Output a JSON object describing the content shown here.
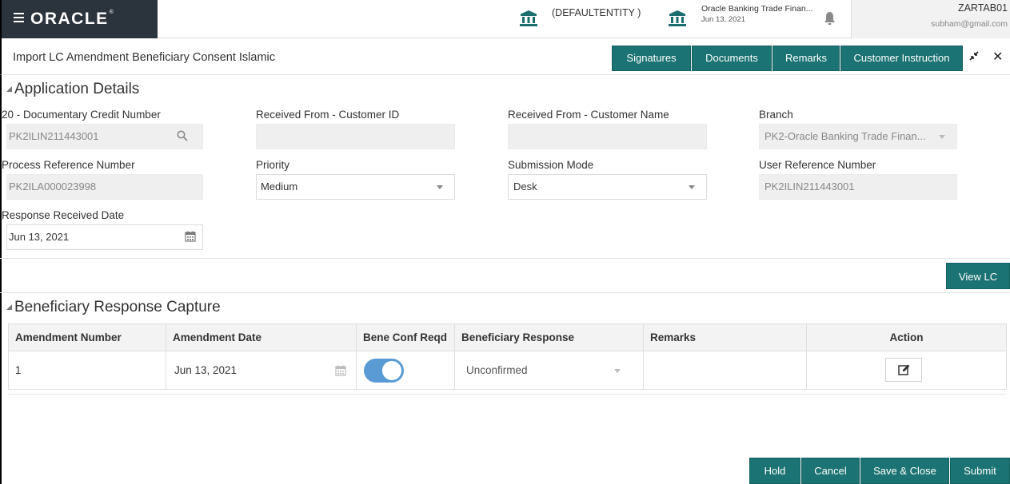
{
  "header": {
    "brand": "ORACLE",
    "entity": "(DEFAULTENTITY )",
    "context_title": "Oracle Banking Trade Finan...",
    "context_date": "Jun 13, 2021",
    "user_name": "ZARTAB01",
    "user_email": "subham@gmail.com"
  },
  "titlebar": {
    "title": "Import LC Amendment Beneficiary Consent Islamic",
    "buttons": [
      "Signatures",
      "Documents",
      "Remarks",
      "Customer Instruction"
    ]
  },
  "application_details": {
    "heading": "Application Details",
    "documentary_credit_number": {
      "label": "20 - Documentary Credit Number",
      "value": "PK2ILIN211443001"
    },
    "customer_id": {
      "label": "Received From - Customer ID",
      "value": ""
    },
    "customer_name": {
      "label": "Received From - Customer Name",
      "value": ""
    },
    "branch": {
      "label": "Branch",
      "value": "PK2-Oracle Banking Trade Finan..."
    },
    "process_reference": {
      "label": "Process Reference Number",
      "value": "PK2ILA000023998"
    },
    "priority": {
      "label": "Priority",
      "value": "Medium"
    },
    "submission_mode": {
      "label": "Submission Mode",
      "value": "Desk"
    },
    "user_reference": {
      "label": "User Reference Number",
      "value": "PK2ILIN211443001"
    },
    "response_received_date": {
      "label": "Response Received Date",
      "value": "Jun 13, 2021"
    }
  },
  "view_lc_label": "View LC",
  "beneficiary_response": {
    "heading": "Beneficiary Response Capture",
    "columns": [
      "Amendment Number",
      "Amendment Date",
      "Bene Conf Reqd",
      "Beneficiary Response",
      "Remarks",
      "Action"
    ],
    "rows": [
      {
        "amendment_number": "1",
        "amendment_date": "Jun 13, 2021",
        "bene_conf_reqd": true,
        "response": "Unconfirmed",
        "remarks": ""
      }
    ]
  },
  "footer": {
    "hold": "Hold",
    "cancel": "Cancel",
    "save_close": "Save & Close",
    "submit": "Submit"
  },
  "colors": {
    "brand_bar": "#2b333d",
    "button": "#1c7373",
    "toggle": "#5b9bd5"
  }
}
